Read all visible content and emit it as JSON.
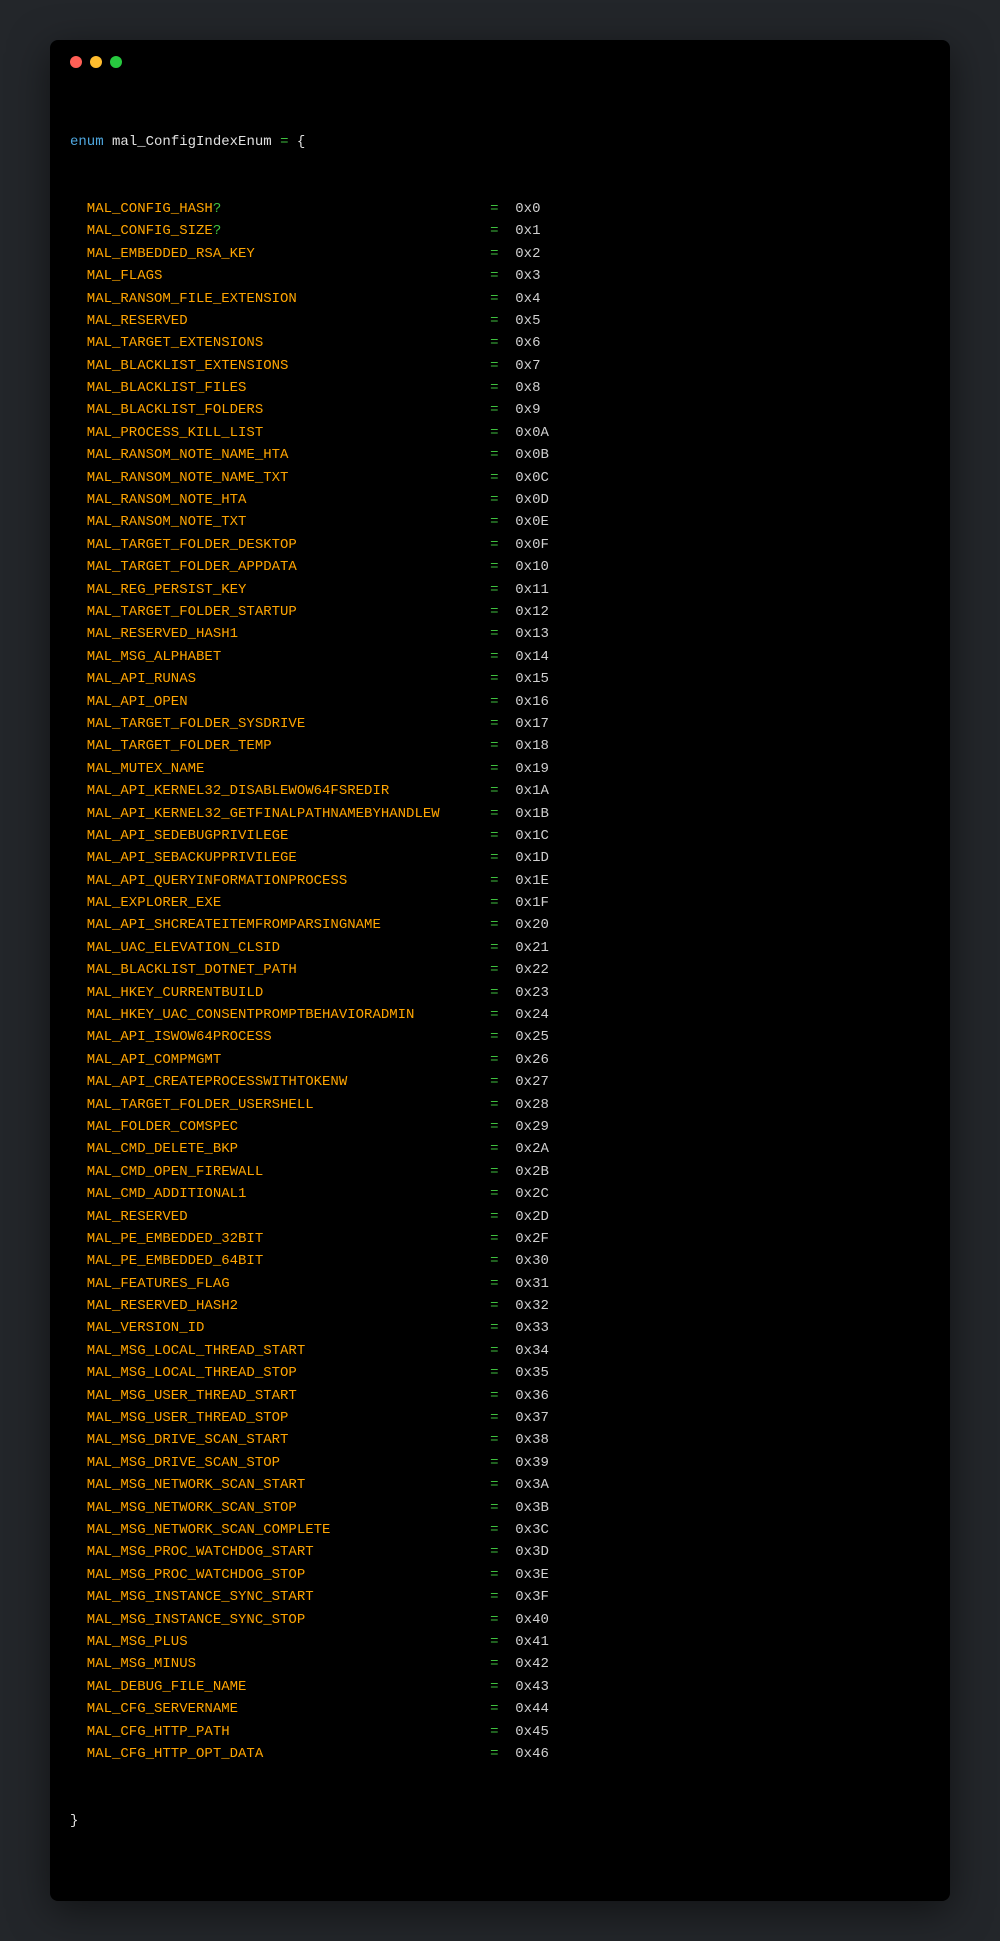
{
  "header": {
    "keyword": "enum",
    "identifier": "mal_ConfigIndexEnum",
    "equals": "=",
    "open_brace": "{",
    "close_brace": "}"
  },
  "entries": [
    {
      "name": "MAL_CONFIG_HASH",
      "suffix": "?",
      "value": "0x0"
    },
    {
      "name": "MAL_CONFIG_SIZE",
      "suffix": "?",
      "value": "0x1"
    },
    {
      "name": "MAL_EMBEDDED_RSA_KEY",
      "suffix": "",
      "value": "0x2"
    },
    {
      "name": "MAL_FLAGS",
      "suffix": "",
      "value": "0x3"
    },
    {
      "name": "MAL_RANSOM_FILE_EXTENSION",
      "suffix": "",
      "value": "0x4"
    },
    {
      "name": "MAL_RESERVED",
      "suffix": "",
      "value": "0x5"
    },
    {
      "name": "MAL_TARGET_EXTENSIONS",
      "suffix": "",
      "value": "0x6"
    },
    {
      "name": "MAL_BLACKLIST_EXTENSIONS",
      "suffix": "",
      "value": "0x7"
    },
    {
      "name": "MAL_BLACKLIST_FILES",
      "suffix": "",
      "value": "0x8"
    },
    {
      "name": "MAL_BLACKLIST_FOLDERS",
      "suffix": "",
      "value": "0x9"
    },
    {
      "name": "MAL_PROCESS_KILL_LIST",
      "suffix": "",
      "value": "0x0A"
    },
    {
      "name": "MAL_RANSOM_NOTE_NAME_HTA",
      "suffix": "",
      "value": "0x0B"
    },
    {
      "name": "MAL_RANSOM_NOTE_NAME_TXT",
      "suffix": "",
      "value": "0x0C"
    },
    {
      "name": "MAL_RANSOM_NOTE_HTA",
      "suffix": "",
      "value": "0x0D"
    },
    {
      "name": "MAL_RANSOM_NOTE_TXT",
      "suffix": "",
      "value": "0x0E"
    },
    {
      "name": "MAL_TARGET_FOLDER_DESKTOP",
      "suffix": "",
      "value": "0x0F"
    },
    {
      "name": "MAL_TARGET_FOLDER_APPDATA",
      "suffix": "",
      "value": "0x10"
    },
    {
      "name": "MAL_REG_PERSIST_KEY",
      "suffix": "",
      "value": "0x11"
    },
    {
      "name": "MAL_TARGET_FOLDER_STARTUP",
      "suffix": "",
      "value": "0x12"
    },
    {
      "name": "MAL_RESERVED_HASH1",
      "suffix": "",
      "value": "0x13"
    },
    {
      "name": "MAL_MSG_ALPHABET",
      "suffix": "",
      "value": "0x14"
    },
    {
      "name": "MAL_API_RUNAS",
      "suffix": "",
      "value": "0x15"
    },
    {
      "name": "MAL_API_OPEN",
      "suffix": "",
      "value": "0x16"
    },
    {
      "name": "MAL_TARGET_FOLDER_SYSDRIVE",
      "suffix": "",
      "value": "0x17"
    },
    {
      "name": "MAL_TARGET_FOLDER_TEMP",
      "suffix": "",
      "value": "0x18"
    },
    {
      "name": "MAL_MUTEX_NAME",
      "suffix": "",
      "value": "0x19"
    },
    {
      "name": "MAL_API_KERNEL32_DISABLEWOW64FSREDIR",
      "suffix": "",
      "value": "0x1A"
    },
    {
      "name": "MAL_API_KERNEL32_GETFINALPATHNAMEBYHANDLEW",
      "suffix": "",
      "value": "0x1B"
    },
    {
      "name": "MAL_API_SEDEBUGPRIVILEGE",
      "suffix": "",
      "value": "0x1C"
    },
    {
      "name": "MAL_API_SEBACKUPPRIVILEGE",
      "suffix": "",
      "value": "0x1D"
    },
    {
      "name": "MAL_API_QUERYINFORMATIONPROCESS",
      "suffix": "",
      "value": "0x1E"
    },
    {
      "name": "MAL_EXPLORER_EXE",
      "suffix": "",
      "value": "0x1F"
    },
    {
      "name": "MAL_API_SHCREATEITEMFROMPARSINGNAME",
      "suffix": "",
      "value": "0x20"
    },
    {
      "name": "MAL_UAC_ELEVATION_CLSID",
      "suffix": "",
      "value": "0x21"
    },
    {
      "name": "MAL_BLACKLIST_DOTNET_PATH",
      "suffix": "",
      "value": "0x22"
    },
    {
      "name": "MAL_HKEY_CURRENTBUILD",
      "suffix": "",
      "value": "0x23"
    },
    {
      "name": "MAL_HKEY_UAC_CONSENTPROMPTBEHAVIORADMIN",
      "suffix": "",
      "value": "0x24"
    },
    {
      "name": "MAL_API_ISWOW64PROCESS",
      "suffix": "",
      "value": "0x25"
    },
    {
      "name": "MAL_API_COMPMGMT",
      "suffix": "",
      "value": "0x26"
    },
    {
      "name": "MAL_API_CREATEPROCESSWITHTOKENW",
      "suffix": "",
      "value": "0x27"
    },
    {
      "name": "MAL_TARGET_FOLDER_USERSHELL",
      "suffix": "",
      "value": "0x28"
    },
    {
      "name": "MAL_FOLDER_COMSPEC",
      "suffix": "",
      "value": "0x29"
    },
    {
      "name": "MAL_CMD_DELETE_BKP",
      "suffix": "",
      "value": "0x2A"
    },
    {
      "name": "MAL_CMD_OPEN_FIREWALL",
      "suffix": "",
      "value": "0x2B"
    },
    {
      "name": "MAL_CMD_ADDITIONAL1",
      "suffix": "",
      "value": "0x2C"
    },
    {
      "name": "MAL_RESERVED",
      "suffix": "",
      "value": "0x2D"
    },
    {
      "name": "MAL_PE_EMBEDDED_32BIT",
      "suffix": "",
      "value": "0x2F"
    },
    {
      "name": "MAL_PE_EMBEDDED_64BIT",
      "suffix": "",
      "value": "0x30"
    },
    {
      "name": "MAL_FEATURES_FLAG",
      "suffix": "",
      "value": "0x31"
    },
    {
      "name": "MAL_RESERVED_HASH2",
      "suffix": "",
      "value": "0x32"
    },
    {
      "name": "MAL_VERSION_ID",
      "suffix": "",
      "value": "0x33"
    },
    {
      "name": "MAL_MSG_LOCAL_THREAD_START",
      "suffix": "",
      "value": "0x34"
    },
    {
      "name": "MAL_MSG_LOCAL_THREAD_STOP",
      "suffix": "",
      "value": "0x35"
    },
    {
      "name": "MAL_MSG_USER_THREAD_START",
      "suffix": "",
      "value": "0x36"
    },
    {
      "name": "MAL_MSG_USER_THREAD_STOP",
      "suffix": "",
      "value": "0x37"
    },
    {
      "name": "MAL_MSG_DRIVE_SCAN_START",
      "suffix": "",
      "value": "0x38"
    },
    {
      "name": "MAL_MSG_DRIVE_SCAN_STOP",
      "suffix": "",
      "value": "0x39"
    },
    {
      "name": "MAL_MSG_NETWORK_SCAN_START",
      "suffix": "",
      "value": "0x3A"
    },
    {
      "name": "MAL_MSG_NETWORK_SCAN_STOP",
      "suffix": "",
      "value": "0x3B"
    },
    {
      "name": "MAL_MSG_NETWORK_SCAN_COMPLETE",
      "suffix": "",
      "value": "0x3C"
    },
    {
      "name": "MAL_MSG_PROC_WATCHDOG_START",
      "suffix": "",
      "value": "0x3D"
    },
    {
      "name": "MAL_MSG_PROC_WATCHDOG_STOP",
      "suffix": "",
      "value": "0x3E"
    },
    {
      "name": "MAL_MSG_INSTANCE_SYNC_START",
      "suffix": "",
      "value": "0x3F"
    },
    {
      "name": "MAL_MSG_INSTANCE_SYNC_STOP",
      "suffix": "",
      "value": "0x40"
    },
    {
      "name": "MAL_MSG_PLUS",
      "suffix": "",
      "value": "0x41"
    },
    {
      "name": "MAL_MSG_MINUS",
      "suffix": "",
      "value": "0x42"
    },
    {
      "name": "MAL_DEBUG_FILE_NAME",
      "suffix": "",
      "value": "0x43"
    },
    {
      "name": "MAL_CFG_SERVERNAME",
      "suffix": "",
      "value": "0x44"
    },
    {
      "name": "MAL_CFG_HTTP_PATH",
      "suffix": "",
      "value": "0x45"
    },
    {
      "name": "MAL_CFG_HTTP_OPT_DATA",
      "suffix": "",
      "value": "0x46"
    }
  ]
}
